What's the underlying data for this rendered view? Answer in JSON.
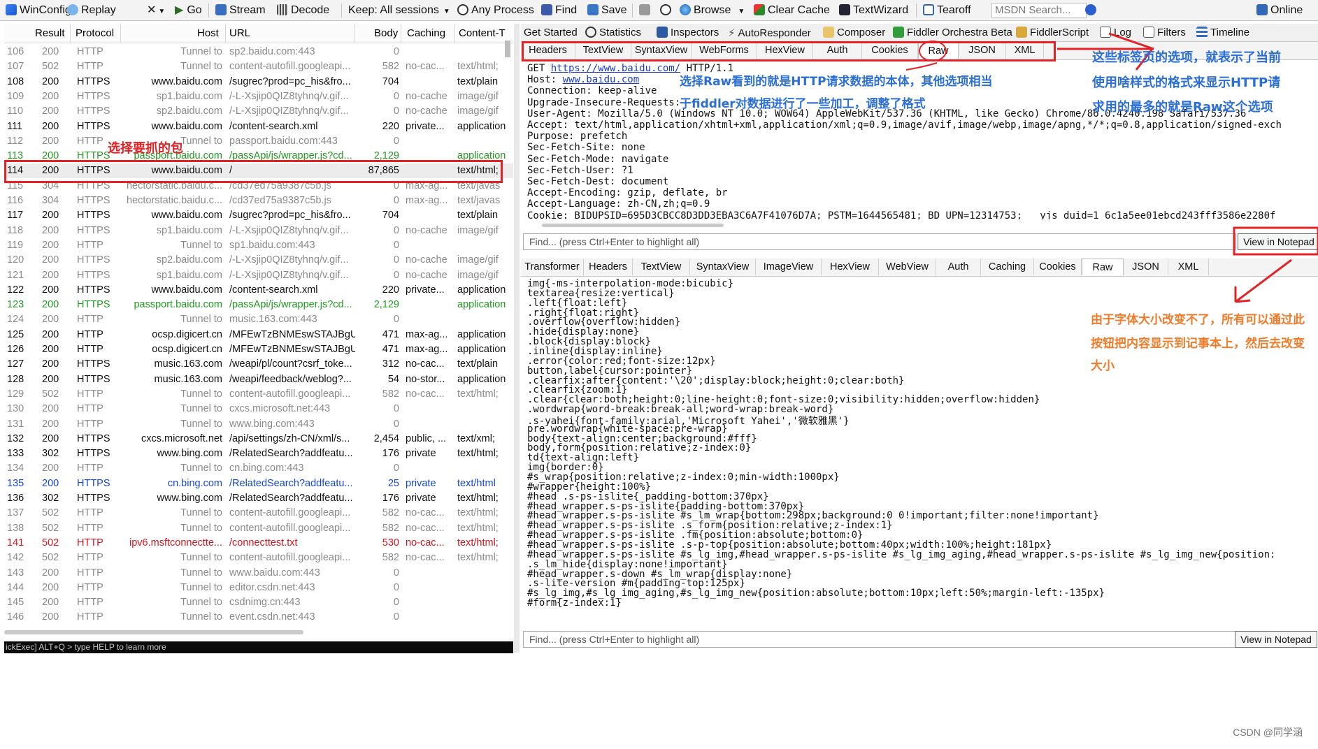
{
  "toolbar": {
    "items": [
      "WinConfig",
      "Replay",
      "Go",
      "Stream",
      "Decode",
      "Keep: All sessions",
      "Any Process",
      "Find",
      "Save",
      "Browse",
      "Clear Cache",
      "TextWizard",
      "Tearoff",
      "MSDN Search...",
      "Online"
    ]
  },
  "sessions": {
    "columns": [
      "Result",
      "Protocol",
      "Host",
      "URL",
      "Body",
      "Caching",
      "Content-T"
    ],
    "rows": [
      {
        "id": "106",
        "result": "200",
        "protocol": "HTTP",
        "host": "Tunnel to",
        "url": "sp2.baidu.com:443",
        "body": "0",
        "caching": "",
        "ct": "",
        "style": "tunnel"
      },
      {
        "id": "107",
        "result": "502",
        "protocol": "HTTP",
        "host": "Tunnel to",
        "url": "content-autofill.googleapi...",
        "body": "582",
        "caching": "no-cac...",
        "ct": "text/html;",
        "style": "tunnel"
      },
      {
        "id": "108",
        "result": "200",
        "protocol": "HTTPS",
        "host": "www.baidu.com",
        "url": "/sugrec?prod=pc_his&fro...",
        "body": "704",
        "caching": "",
        "ct": "text/plain",
        "style": ""
      },
      {
        "id": "109",
        "result": "200",
        "protocol": "HTTPS",
        "host": "sp1.baidu.com",
        "url": "/-L-Xsjip0QIZ8tyhnq/v.gif...",
        "body": "0",
        "caching": "no-cache",
        "ct": "image/gif",
        "style": "tunnel"
      },
      {
        "id": "110",
        "result": "200",
        "protocol": "HTTPS",
        "host": "sp2.baidu.com",
        "url": "/-L-Xsjip0QIZ8tyhnq/v.gif...",
        "body": "0",
        "caching": "no-cache",
        "ct": "image/gif",
        "style": "tunnel"
      },
      {
        "id": "111",
        "result": "200",
        "protocol": "HTTPS",
        "host": "www.baidu.com",
        "url": "/content-search.xml",
        "body": "220",
        "caching": "private...",
        "ct": "application",
        "style": ""
      },
      {
        "id": "112",
        "result": "200",
        "protocol": "HTTP",
        "host": "Tunnel to",
        "url": "passport.baidu.com:443",
        "body": "0",
        "caching": "",
        "ct": "",
        "style": "tunnel"
      },
      {
        "id": "113",
        "result": "200",
        "protocol": "HTTPS",
        "host": "passport.baidu.com",
        "url": "/passApi/js/wrapper.js?cd...",
        "body": "2,129",
        "caching": "",
        "ct": "application",
        "style": "green"
      },
      {
        "id": "114",
        "result": "200",
        "protocol": "HTTPS",
        "host": "www.baidu.com",
        "url": "/",
        "body": "87,865",
        "caching": "",
        "ct": "text/html;",
        "style": "selected"
      },
      {
        "id": "115",
        "result": "304",
        "protocol": "HTTPS",
        "host": "hectorstatic.baidu.c...",
        "url": "/cd37ed75a9387c5b.js",
        "body": "0",
        "caching": "max-ag...",
        "ct": "text/javas",
        "style": "tunnel"
      },
      {
        "id": "116",
        "result": "304",
        "protocol": "HTTPS",
        "host": "hectorstatic.baidu.c...",
        "url": "/cd37ed75a9387c5b.js",
        "body": "0",
        "caching": "max-ag...",
        "ct": "text/javas",
        "style": "tunnel"
      },
      {
        "id": "117",
        "result": "200",
        "protocol": "HTTPS",
        "host": "www.baidu.com",
        "url": "/sugrec?prod=pc_his&fro...",
        "body": "704",
        "caching": "",
        "ct": "text/plain",
        "style": ""
      },
      {
        "id": "118",
        "result": "200",
        "protocol": "HTTPS",
        "host": "sp1.baidu.com",
        "url": "/-L-Xsjip0QIZ8tyhnq/v.gif...",
        "body": "0",
        "caching": "no-cache",
        "ct": "image/gif",
        "style": "tunnel"
      },
      {
        "id": "119",
        "result": "200",
        "protocol": "HTTP",
        "host": "Tunnel to",
        "url": "sp1.baidu.com:443",
        "body": "0",
        "caching": "",
        "ct": "",
        "style": "tunnel"
      },
      {
        "id": "120",
        "result": "200",
        "protocol": "HTTPS",
        "host": "sp2.baidu.com",
        "url": "/-L-Xsjip0QIZ8tyhnq/v.gif...",
        "body": "0",
        "caching": "no-cache",
        "ct": "image/gif",
        "style": "tunnel"
      },
      {
        "id": "121",
        "result": "200",
        "protocol": "HTTPS",
        "host": "sp1.baidu.com",
        "url": "/-L-Xsjip0QIZ8tyhnq/v.gif...",
        "body": "0",
        "caching": "no-cache",
        "ct": "image/gif",
        "style": "tunnel"
      },
      {
        "id": "122",
        "result": "200",
        "protocol": "HTTPS",
        "host": "www.baidu.com",
        "url": "/content-search.xml",
        "body": "220",
        "caching": "private...",
        "ct": "application",
        "style": ""
      },
      {
        "id": "123",
        "result": "200",
        "protocol": "HTTPS",
        "host": "passport.baidu.com",
        "url": "/passApi/js/wrapper.js?cd...",
        "body": "2,129",
        "caching": "",
        "ct": "application",
        "style": "green"
      },
      {
        "id": "124",
        "result": "200",
        "protocol": "HTTP",
        "host": "Tunnel to",
        "url": "music.163.com:443",
        "body": "0",
        "caching": "",
        "ct": "",
        "style": "tunnel"
      },
      {
        "id": "125",
        "result": "200",
        "protocol": "HTTP",
        "host": "ocsp.digicert.cn",
        "url": "/MFEwTzBNMEswSTAJBgU...",
        "body": "471",
        "caching": "max-ag...",
        "ct": "application",
        "style": ""
      },
      {
        "id": "126",
        "result": "200",
        "protocol": "HTTP",
        "host": "ocsp.digicert.cn",
        "url": "/MFEwTzBNMEswSTAJBgU...",
        "body": "471",
        "caching": "max-ag...",
        "ct": "application",
        "style": ""
      },
      {
        "id": "127",
        "result": "200",
        "protocol": "HTTPS",
        "host": "music.163.com",
        "url": "/weapi/pl/count?csrf_toke...",
        "body": "312",
        "caching": "no-cac...",
        "ct": "text/plain",
        "style": ""
      },
      {
        "id": "128",
        "result": "200",
        "protocol": "HTTPS",
        "host": "music.163.com",
        "url": "/weapi/feedback/weblog?...",
        "body": "54",
        "caching": "no-stor...",
        "ct": "application",
        "style": ""
      },
      {
        "id": "129",
        "result": "502",
        "protocol": "HTTP",
        "host": "Tunnel to",
        "url": "content-autofill.googleapi...",
        "body": "582",
        "caching": "no-cac...",
        "ct": "text/html;",
        "style": "tunnel"
      },
      {
        "id": "130",
        "result": "200",
        "protocol": "HTTP",
        "host": "Tunnel to",
        "url": "cxcs.microsoft.net:443",
        "body": "0",
        "caching": "",
        "ct": "",
        "style": "tunnel"
      },
      {
        "id": "131",
        "result": "200",
        "protocol": "HTTP",
        "host": "Tunnel to",
        "url": "www.bing.com:443",
        "body": "0",
        "caching": "",
        "ct": "",
        "style": "tunnel"
      },
      {
        "id": "132",
        "result": "200",
        "protocol": "HTTPS",
        "host": "cxcs.microsoft.net",
        "url": "/api/settings/zh-CN/xml/s...",
        "body": "2,454",
        "caching": "public, ...",
        "ct": "text/xml;",
        "style": ""
      },
      {
        "id": "133",
        "result": "302",
        "protocol": "HTTPS",
        "host": "www.bing.com",
        "url": "/RelatedSearch?addfeatu...",
        "body": "176",
        "caching": "private",
        "ct": "text/html;",
        "style": ""
      },
      {
        "id": "134",
        "result": "200",
        "protocol": "HTTP",
        "host": "Tunnel to",
        "url": "cn.bing.com:443",
        "body": "0",
        "caching": "",
        "ct": "",
        "style": "tunnel"
      },
      {
        "id": "135",
        "result": "200",
        "protocol": "HTTPS",
        "host": "cn.bing.com",
        "url": "/RelatedSearch?addfeatu...",
        "body": "25",
        "caching": "private",
        "ct": "text/html",
        "style": "blue"
      },
      {
        "id": "136",
        "result": "302",
        "protocol": "HTTPS",
        "host": "www.bing.com",
        "url": "/RelatedSearch?addfeatu...",
        "body": "176",
        "caching": "private",
        "ct": "text/html;",
        "style": ""
      },
      {
        "id": "137",
        "result": "502",
        "protocol": "HTTP",
        "host": "Tunnel to",
        "url": "content-autofill.googleapi...",
        "body": "582",
        "caching": "no-cac...",
        "ct": "text/html;",
        "style": "tunnel"
      },
      {
        "id": "138",
        "result": "502",
        "protocol": "HTTP",
        "host": "Tunnel to",
        "url": "content-autofill.googleapi...",
        "body": "582",
        "caching": "no-cac...",
        "ct": "text/html;",
        "style": "tunnel"
      },
      {
        "id": "141",
        "result": "502",
        "protocol": "HTTP",
        "host": "ipv6.msftconnectte...",
        "url": "/connecttest.txt",
        "body": "530",
        "caching": "no-cac...",
        "ct": "text/html;",
        "style": "red"
      },
      {
        "id": "142",
        "result": "502",
        "protocol": "HTTP",
        "host": "Tunnel to",
        "url": "content-autofill.googleapi...",
        "body": "582",
        "caching": "no-cac...",
        "ct": "text/html;",
        "style": "tunnel"
      },
      {
        "id": "143",
        "result": "200",
        "protocol": "HTTP",
        "host": "Tunnel to",
        "url": "www.baidu.com:443",
        "body": "0",
        "caching": "",
        "ct": "",
        "style": "tunnel"
      },
      {
        "id": "144",
        "result": "200",
        "protocol": "HTTP",
        "host": "Tunnel to",
        "url": "editor.csdn.net:443",
        "body": "0",
        "caching": "",
        "ct": "",
        "style": "tunnel"
      },
      {
        "id": "145",
        "result": "200",
        "protocol": "HTTP",
        "host": "Tunnel to",
        "url": "csdnimg.cn:443",
        "body": "0",
        "caching": "",
        "ct": "",
        "style": "tunnel"
      },
      {
        "id": "146",
        "result": "200",
        "protocol": "HTTP",
        "host": "Tunnel to",
        "url": "event.csdn.net:443",
        "body": "0",
        "caching": "",
        "ct": "",
        "style": "tunnel"
      }
    ]
  },
  "quickexec": "ickExec] ALT+Q > type HELP to learn more",
  "inspector_tabs": [
    "Get Started",
    "Statistics",
    "Inspectors",
    "AutoResponder",
    "Composer",
    "Fiddler Orchestra Beta",
    "FiddlerScript",
    "Log",
    "Filters",
    "Timeline"
  ],
  "request_tabs": [
    "Headers",
    "TextView",
    "SyntaxView",
    "WebForms",
    "HexView",
    "Auth",
    "Cookies",
    "Raw",
    "JSON",
    "XML"
  ],
  "request_active": "Raw",
  "request_lines": [
    "GET https://www.baidu.com/ HTTP/1.1",
    "Host: www.baidu.com",
    "Connection: keep-alive",
    "Upgrade-Insecure-Requests:",
    "User-Agent: Mozilla/5.0 (Windows NT 10.0; WOW64) AppleWebKit/537.36 (KHTML, like Gecko) Chrome/86.0.4240.198 Safari/537.36",
    "Accept: text/html,application/xhtml+xml,application/xml;q=0.9,image/avif,image/webp,image/apng,*/*;q=0.8,application/signed-exch",
    "Purpose: prefetch",
    "Sec-Fetch-Site: none",
    "Sec-Fetch-Mode: navigate",
    "Sec-Fetch-User: ?1",
    "Sec-Fetch-Dest: document",
    "Accept-Encoding: gzip, deflate, br",
    "Accept-Language: zh-CN,zh;q=0.9",
    "Cookie: BIDUPSID=695D3CBCC8D3DD3EBA3C6A7F41076D7A; PSTM=1644565481; BD_UPN=12314753; __yjs_duid=1_6c1a5ee01ebcd243fff3586e2280f"
  ],
  "request_url_text": "https://www.baidu.com/",
  "request_host_text": "www.baidu.com",
  "find_placeholder": "Find... (press Ctrl+Enter to highlight all)",
  "view_notepad": "View in Notepad",
  "response_tabs": [
    "Transformer",
    "Headers",
    "TextView",
    "SyntaxView",
    "ImageView",
    "HexView",
    "WebView",
    "Auth",
    "Caching",
    "Cookies",
    "Raw",
    "JSON",
    "XML"
  ],
  "response_active": "Raw",
  "response_lines": [
    "img{-ms-interpolation-mode:bicubic}",
    "textarea{resize:vertical}",
    ".left{float:left}",
    ".right{float:right}",
    ".overflow{overflow:hidden}",
    ".hide{display:none}",
    ".block{display:block}",
    ".inline{display:inline}",
    ".error{color:red;font-size:12px}",
    "button,label{cursor:pointer}",
    ".clearfix:after{content:'\\20';display:block;height:0;clear:both}",
    ".clearfix{zoom:1}",
    ".clear{clear:both;height:0;line-height:0;font-size:0;visibility:hidden;overflow:hidden}",
    ".wordwrap{word-break:break-all;word-wrap:break-word}",
    ".s-yahei{font-family:arial,'Microsoft Yahei','微软雅黑'}",
    "pre.wordwrap{white-space:pre-wrap}",
    "body{text-align:center;background:#fff}",
    "body,form{position:relative;z-index:0}",
    "td{text-align:left}",
    "img{border:0}",
    "#s_wrap{position:relative;z-index:0;min-width:1000px}",
    "#wrapper{height:100%}",
    "#head .s-ps-islite{_padding-bottom:370px}",
    "#head_wrapper.s-ps-islite{padding-bottom:370px}",
    "#head_wrapper.s-ps-islite #s_lm_wrap{bottom:298px;background:0 0!important;filter:none!important}",
    "#head_wrapper.s-ps-islite .s_form{position:relative;z-index:1}",
    "#head_wrapper.s-ps-islite .fm{position:absolute;bottom:0}",
    "#head_wrapper.s-ps-islite .s-p-top{position:absolute;bottom:40px;width:100%;height:181px}",
    "#head_wrapper.s-ps-islite #s_lg_img,#head_wrapper.s-ps-islite #s_lg_img_aging,#head_wrapper.s-ps-islite #s_lg_img_new{position:",
    ".s_lm_hide{display:none!important}",
    "#head_wrapper.s-down #s_lm_wrap{display:none}",
    ".s-lite-version #m{padding-top:125px}",
    "#s_lg_img,#s_lg_img_aging,#s_lg_img_new{position:absolute;bottom:10px;left:50%;margin-left:-135px}",
    "#form{z-index:1}"
  ],
  "annotations": {
    "select_packet": "选择要抓的包",
    "raw_note_1": "选择Raw看到的就是HTTP请求数据的本体，其他选项相当",
    "raw_note_2": "于fiddler对数据进行了一些加工，调整了格式",
    "tabs_note_1": "这些标签页的选项，就表示了当前",
    "tabs_note_2": "使用啥样式的格式来显示HTTP请",
    "tabs_note_3": "求用的最多的就是Raw这个选项",
    "notepad_note_1": "由于字体大小改变不了，所有可以通过此",
    "notepad_note_2": "按钮把内容显示到记事本上，然后去改变",
    "notepad_note_3": "大小"
  },
  "watermark": "CSDN @同学涵",
  "colors": {
    "annotation_red": "#e32226",
    "annotation_blue": "#2b6fd6",
    "annotation_orange": "#f07b28",
    "tunnel_gray": "#8a8a8a",
    "row_green": "#1f9a1f",
    "row_blue": "#1547d6",
    "row_red": "#d8141e"
  }
}
